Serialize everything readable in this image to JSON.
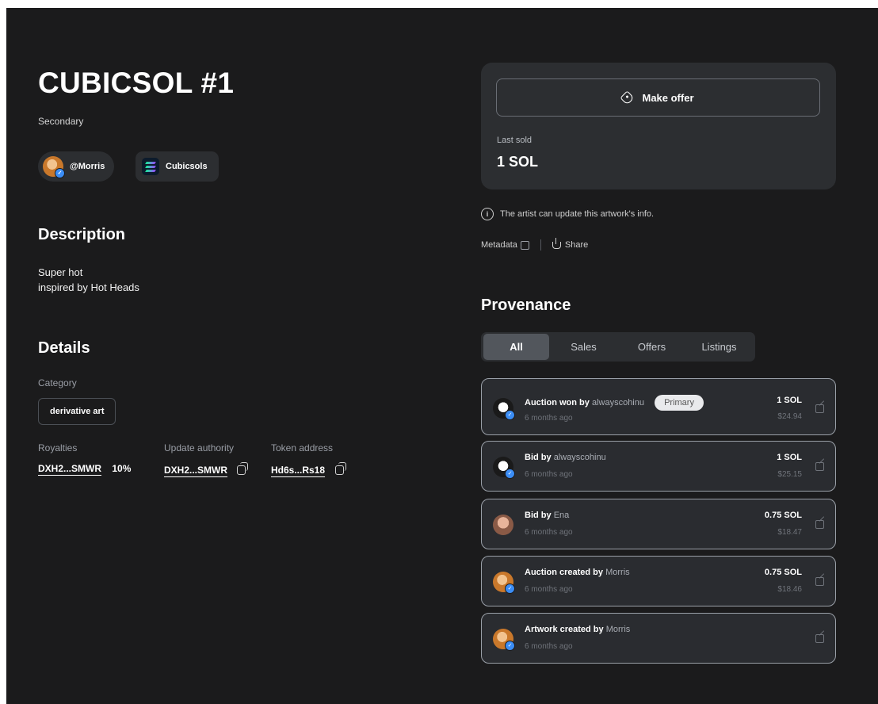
{
  "artwork": {
    "title": "CUBICSOL #1",
    "subtitle": "Secondary",
    "creator": "@Morris",
    "collection": "Cubicsols"
  },
  "description": {
    "heading": "Description",
    "lines": [
      "Super hot",
      "inspired by Hot Heads"
    ]
  },
  "details": {
    "heading": "Details",
    "category_label": "Category",
    "category_value": "derivative art",
    "royalties_label": "Royalties",
    "royalties_address": "DXH2...SMWR",
    "royalties_percent": "10%",
    "update_authority_label": "Update authority",
    "update_authority_value": "DXH2...SMWR",
    "token_address_label": "Token address",
    "token_address_value": "Hd6s...Rs18"
  },
  "offer_panel": {
    "make_offer_label": "Make offer",
    "last_sold_label": "Last sold",
    "last_sold_value": "1 SOL"
  },
  "notice": "The artist can update this artwork's info.",
  "links": {
    "metadata": "Metadata",
    "share": "Share"
  },
  "provenance": {
    "heading": "Provenance",
    "tabs": [
      "All",
      "Sales",
      "Offers",
      "Listings"
    ],
    "active_tab": "All",
    "events": [
      {
        "action": "Auction won by",
        "user": "alwayscohinu",
        "badge": "Primary",
        "time": "6 months ago",
        "sol": "1 SOL",
        "usd": "$24.94",
        "avatar": "ghost"
      },
      {
        "action": "Bid by",
        "user": "alwayscohinu",
        "time": "6 months ago",
        "sol": "1 SOL",
        "usd": "$25.15",
        "avatar": "ghost"
      },
      {
        "action": "Bid by",
        "user": "Ena",
        "time": "6 months ago",
        "sol": "0.75 SOL",
        "usd": "$18.47",
        "avatar": "ena"
      },
      {
        "action": "Auction created by",
        "user": "Morris",
        "time": "6 months ago",
        "sol": "0.75 SOL",
        "usd": "$18.46",
        "avatar": "morris"
      },
      {
        "action": "Artwork created by",
        "user": "Morris",
        "time": "6 months ago",
        "avatar": "morris"
      }
    ]
  },
  "colors": {
    "background": "#1b1b1c",
    "card": "#2c2e31",
    "verified": "#3b8df5",
    "muted_text": "#9a9ea6"
  }
}
